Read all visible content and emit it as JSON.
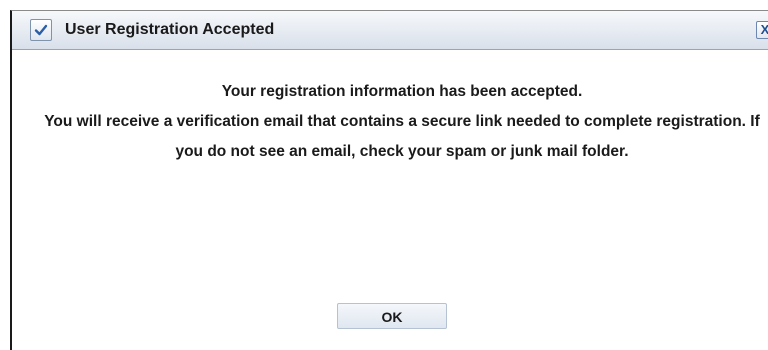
{
  "dialog": {
    "title": "User Registration Accepted",
    "title_icon": "checkmark-icon",
    "close_label": "X",
    "message_line_1": "Your registration information has been accepted.",
    "message_line_2": "You will receive a verification email that contains a secure link needed to complete registration. If you do not see an email, check your spam or junk mail folder.",
    "ok_label": "OK"
  },
  "colors": {
    "titlebar": "#e6ebf2",
    "text": "#1a1a1a",
    "close_icon": "#1f4f8f",
    "check": "#2a5fa8"
  }
}
